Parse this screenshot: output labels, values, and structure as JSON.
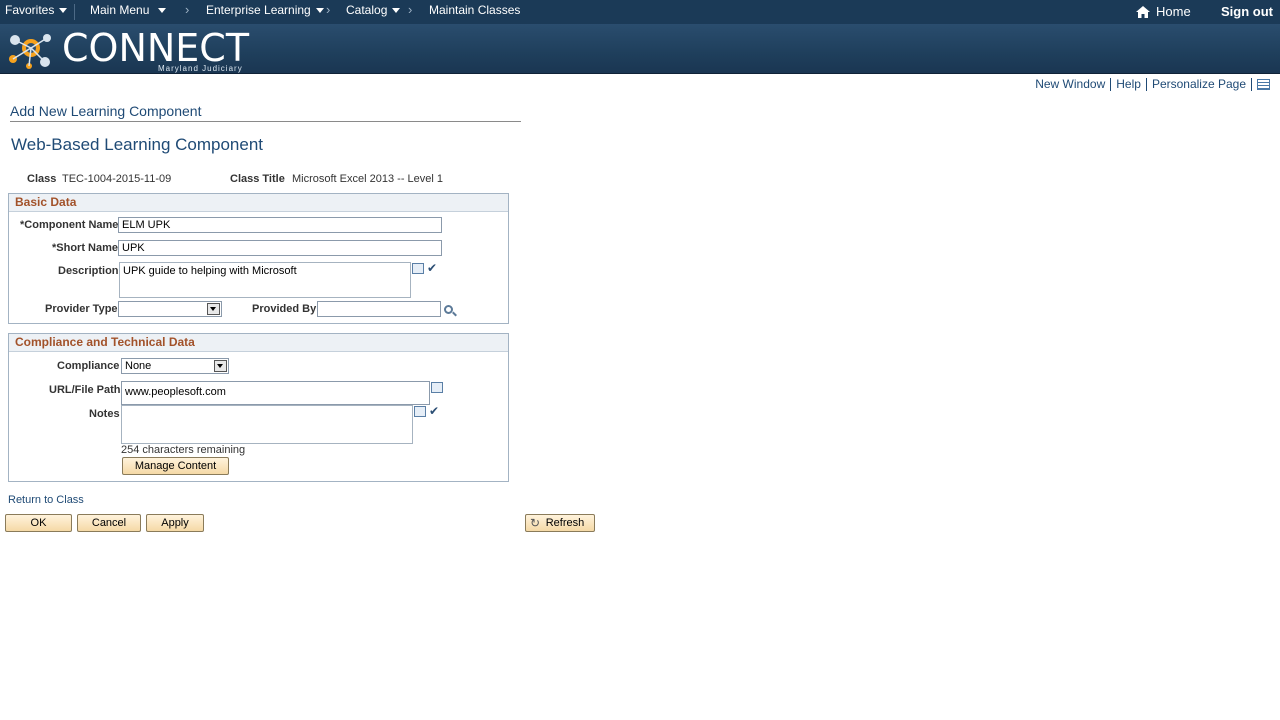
{
  "nav": {
    "favorites": "Favorites",
    "main_menu": "Main Menu",
    "enterprise_learning": "Enterprise Learning",
    "catalog": "Catalog",
    "maintain_classes": "Maintain Classes",
    "home": "Home",
    "sign_out": "Sign out"
  },
  "banner": {
    "logo": "CONNECT",
    "subtitle": "Maryland Judiciary"
  },
  "page_links": {
    "new_window": "New Window",
    "help": "Help",
    "personalize": "Personalize Page"
  },
  "page": {
    "breadcrumb_title": "Add New Learning Component",
    "title": "Web-Based Learning Component",
    "class_label": "Class",
    "class_value": "TEC-1004-2015-11-09",
    "class_title_label": "Class Title",
    "class_title_value": "Microsoft Excel 2013 -- Level 1"
  },
  "basic_data": {
    "heading": "Basic Data",
    "component_name_label": "*Component Name",
    "component_name_value": "ELM UPK",
    "short_name_label": "*Short Name",
    "short_name_value": "UPK",
    "description_label": "Description",
    "description_value": "UPK guide to helping with Microsoft",
    "provider_type_label": "Provider Type",
    "provider_type_value": "",
    "provided_by_label": "Provided By",
    "provided_by_value": ""
  },
  "compliance": {
    "heading": "Compliance and Technical Data",
    "compliance_label": "Compliance",
    "compliance_value": "None",
    "url_label": "URL/File Path",
    "url_value": "www.peoplesoft.com",
    "notes_label": "Notes",
    "notes_value": "",
    "chars_remaining": "254 characters remaining",
    "manage_content": "Manage Content"
  },
  "actions": {
    "return_to_class": "Return to Class",
    "ok": "OK",
    "cancel": "Cancel",
    "apply": "Apply",
    "refresh": "Refresh"
  }
}
